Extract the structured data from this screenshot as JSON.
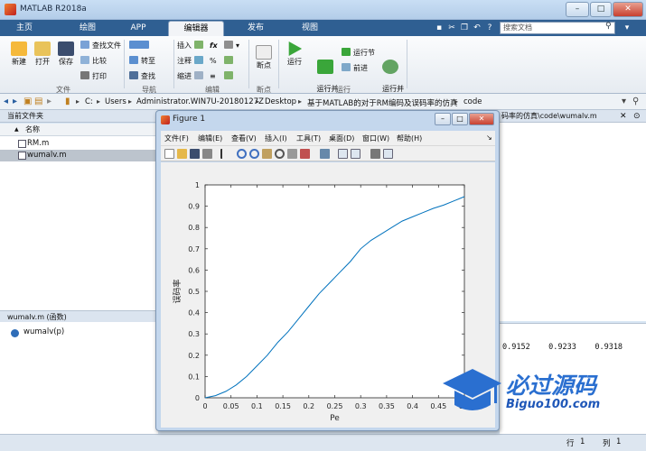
{
  "window": {
    "title": "MATLAB R2018a",
    "controls": {
      "minimize": "–",
      "maximize": "□",
      "close": "✕"
    }
  },
  "ribbon_tabs": [
    {
      "label": "主页",
      "active": false
    },
    {
      "label": "绘图",
      "active": false
    },
    {
      "label": "APP",
      "active": false
    },
    {
      "label": "编辑器",
      "active": true
    },
    {
      "label": "发布",
      "active": false
    },
    {
      "label": "视图",
      "active": false
    }
  ],
  "search": {
    "placeholder": "搜索文档"
  },
  "ribbon": {
    "file": {
      "new": "新建",
      "open": "打开",
      "save": "保存",
      "find_files": "查找文件",
      "compare": "比较",
      "print": "打印",
      "group": "文件"
    },
    "nav": {
      "goto": "转至",
      "find": "查找",
      "group": "导航"
    },
    "edit": {
      "insert": "插入",
      "comment": "注释",
      "indent": "缩进",
      "fx": "fx",
      "group": "编辑"
    },
    "breakpoints": {
      "label": "断点",
      "group": "断点"
    },
    "run": {
      "run": "运行",
      "run_advance": "运行并\n前进",
      "run_section": "运行节",
      "advance": "前进",
      "run_time": "运行并\n计时",
      "group": "运行"
    }
  },
  "address": {
    "crumbs": [
      "C:",
      "Users",
      "Administrator.WIN7U-20180127Z",
      "Desktop",
      "基于MATLAB的对于RM编码及误码率的仿真",
      "code"
    ]
  },
  "left_panel": {
    "header": "当前文件夹",
    "column": "名称",
    "sort_arrow": "▲",
    "files": [
      {
        "name": "RM.m",
        "selected": false
      },
      {
        "name": "wumalv.m",
        "selected": true
      }
    ],
    "detail_header": "wumalv.m  (函数)",
    "detail_item": "wumalv(p)"
  },
  "editor_path": "码率的仿真\\code\\wumalv.m",
  "command_output": "0.9152    0.9233    0.9318",
  "status": {
    "row_label": "行",
    "row": "1",
    "col_label": "列",
    "col": "1"
  },
  "figure": {
    "title": "Figure 1",
    "menu": [
      "文件(F)",
      "编辑(E)",
      "查看(V)",
      "插入(I)",
      "工具(T)",
      "桌面(D)",
      "窗口(W)",
      "帮助(H)"
    ]
  },
  "chart_data": {
    "type": "line",
    "title": "",
    "xlabel": "Pe",
    "ylabel": "误码率",
    "xlim": [
      0,
      0.5
    ],
    "ylim": [
      0,
      1
    ],
    "xticks": [
      0,
      0.05,
      0.1,
      0.15,
      0.2,
      0.25,
      0.3,
      0.35,
      0.4,
      0.45,
      0.5
    ],
    "yticks": [
      0,
      0.1,
      0.2,
      0.3,
      0.4,
      0.5,
      0.6,
      0.7,
      0.8,
      0.9,
      1
    ],
    "grid": false,
    "color": "#0072bd",
    "x": [
      0,
      0.02,
      0.04,
      0.06,
      0.08,
      0.1,
      0.12,
      0.14,
      0.16,
      0.18,
      0.2,
      0.22,
      0.24,
      0.26,
      0.28,
      0.3,
      0.32,
      0.34,
      0.36,
      0.38,
      0.4,
      0.42,
      0.44,
      0.46,
      0.48,
      0.5
    ],
    "y": [
      0,
      0.01,
      0.03,
      0.06,
      0.1,
      0.15,
      0.2,
      0.26,
      0.31,
      0.37,
      0.43,
      0.49,
      0.54,
      0.59,
      0.64,
      0.7,
      0.74,
      0.77,
      0.8,
      0.83,
      0.85,
      0.87,
      0.89,
      0.905,
      0.925,
      0.945
    ]
  },
  "watermark": {
    "line1": "必过源码",
    "line2": "Biguo100.com"
  }
}
